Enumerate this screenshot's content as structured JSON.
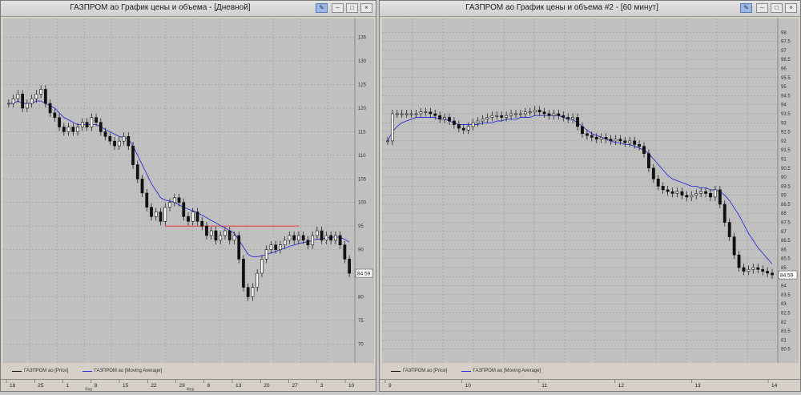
{
  "window1": {
    "title": "ГАЗПРОМ ао График цены и объема - [Дневной]",
    "legend_price": "ГАЗПРОМ ао [Price]",
    "legend_ma": "ГАЗПРОМ ао [Moving Average]",
    "last_price_label": "84.59",
    "x_ticks": [
      "18",
      "25",
      "1",
      "8",
      "15",
      "22",
      "29",
      "6",
      "13",
      "20",
      "27",
      "3",
      "10"
    ],
    "x_sub_labels": [
      "Янв",
      "Фев"
    ],
    "hline_color": "#e23b3b"
  },
  "window2": {
    "title": "ГАЗПРОМ ао График цены и объема #2 - [60 минут]",
    "legend_price": "ГАЗПРОМ ао [Price]",
    "legend_ma": "ГАЗПРОМ ао [Moving Average]",
    "last_price_label": "84.59",
    "x_ticks": [
      "9",
      "10",
      "11",
      "12",
      "13",
      "14"
    ]
  },
  "colors": {
    "ma_line": "#2e2fd0",
    "candle": "#111111",
    "plot_bg": "#c0c0c0"
  },
  "chart_data": [
    {
      "type": "candlestick",
      "interval": "daily",
      "ylim": [
        67,
        138
      ],
      "y_ticks": [
        70,
        75,
        80,
        85,
        90,
        95,
        100,
        105,
        110,
        115,
        120,
        125,
        130,
        135
      ],
      "horizontal_line": 95,
      "series": [
        {
          "name": "ГАЗПРОМ ао [Price]",
          "close": [
            121,
            122,
            123,
            120,
            121,
            122,
            123,
            124,
            121,
            119,
            118,
            116,
            115,
            116,
            115,
            116,
            117,
            116,
            118,
            117,
            115,
            114,
            113,
            112,
            113,
            114,
            112,
            108,
            105,
            102,
            99,
            97,
            98,
            96,
            99,
            100,
            101,
            100,
            97,
            96,
            98,
            96,
            95,
            93,
            94,
            92,
            93,
            94,
            92,
            93,
            88,
            82,
            80,
            82,
            85,
            88,
            90,
            91,
            90,
            91,
            92,
            93,
            92,
            93,
            92,
            91,
            93,
            94,
            92,
            93,
            92,
            93,
            91,
            88,
            85
          ]
        },
        {
          "name": "ГАЗПРОМ ао [Moving Average]",
          "values": [
            121,
            121,
            121.5,
            121,
            121,
            121,
            121.5,
            121.5,
            121,
            120.5,
            120,
            119,
            118,
            117.5,
            117,
            116.5,
            116.5,
            116.5,
            116.5,
            116.5,
            116,
            115.5,
            115,
            114.5,
            114,
            113.8,
            113.5,
            112,
            110,
            108,
            106,
            104,
            102.5,
            101,
            100.5,
            100.3,
            100,
            99.5,
            99,
            98.6,
            98.2,
            97.8,
            97.3,
            96.8,
            96.2,
            95.7,
            95.1,
            94.6,
            94,
            93.5,
            92,
            90.5,
            89,
            88.5,
            88.5,
            88.7,
            89,
            89.3,
            89.6,
            90,
            90.3,
            90.7,
            91,
            91.3,
            91.5,
            91.7,
            92,
            92.2,
            92.3,
            92.5,
            92.6,
            92.7,
            92.6,
            92.2,
            91.6
          ]
        }
      ]
    },
    {
      "type": "candlestick",
      "interval": "60 min",
      "ylim": [
        80,
        98.5
      ],
      "y_ticks": [
        80.5,
        81,
        81.5,
        82,
        82.5,
        83,
        83.5,
        84,
        84.5,
        85,
        85.5,
        86,
        86.5,
        87,
        87.5,
        88,
        88.5,
        89,
        89.5,
        90,
        90.5,
        91,
        91.5,
        92,
        92.5,
        93,
        93.5,
        94,
        94.5,
        95,
        95.5,
        96,
        96.5,
        97,
        97.5,
        98
      ],
      "series": [
        {
          "name": "ГАЗПРОМ ао [Price]",
          "close": [
            92,
            93.5,
            93.5,
            93.5,
            93.5,
            93.5,
            93.5,
            93.6,
            93.6,
            93.5,
            93.4,
            93.2,
            93.3,
            93.1,
            92.9,
            92.7,
            92.6,
            92.8,
            93.0,
            93.1,
            93.2,
            93.3,
            93.4,
            93.4,
            93.3,
            93.4,
            93.5,
            93.5,
            93.5,
            93.6,
            93.6,
            93.7,
            93.6,
            93.5,
            93.4,
            93.5,
            93.4,
            93.3,
            93.2,
            93.3,
            92.8,
            92.4,
            92.3,
            92.2,
            92.1,
            92.2,
            92.1,
            92.0,
            92.1,
            92.0,
            91.9,
            92.0,
            91.8,
            91.7,
            91.3,
            90.5,
            89.9,
            89.5,
            89.3,
            89.2,
            89.1,
            89.2,
            89.0,
            88.9,
            89.0,
            89.1,
            89.2,
            89.1,
            88.9,
            89.3,
            88.5,
            87.5,
            86.7,
            85.7,
            85.0,
            84.8,
            84.9,
            85.0,
            84.9,
            84.8,
            84.7,
            84.6
          ]
        },
        {
          "name": "ГАЗПРОМ ао [Moving Average]",
          "values": [
            92,
            92.5,
            92.8,
            93.0,
            93.1,
            93.2,
            93.3,
            93.3,
            93.3,
            93.3,
            93.3,
            93.2,
            93.2,
            93.1,
            93.0,
            92.9,
            92.9,
            92.9,
            92.9,
            92.9,
            93.0,
            93.0,
            93.0,
            93.1,
            93.1,
            93.2,
            93.2,
            93.2,
            93.3,
            93.3,
            93.3,
            93.4,
            93.4,
            93.4,
            93.4,
            93.4,
            93.4,
            93.3,
            93.2,
            93.2,
            93.0,
            92.8,
            92.6,
            92.4,
            92.3,
            92.2,
            92.1,
            92.0,
            91.9,
            91.9,
            91.8,
            91.8,
            91.7,
            91.6,
            91.5,
            91.3,
            91.0,
            90.7,
            90.4,
            90.1,
            89.9,
            89.8,
            89.7,
            89.6,
            89.5,
            89.5,
            89.4,
            89.4,
            89.3,
            89.3,
            89.2,
            89.0,
            88.7,
            88.3,
            87.9,
            87.4,
            86.9,
            86.5,
            86.1,
            85.8,
            85.5,
            85.2
          ]
        }
      ]
    }
  ]
}
